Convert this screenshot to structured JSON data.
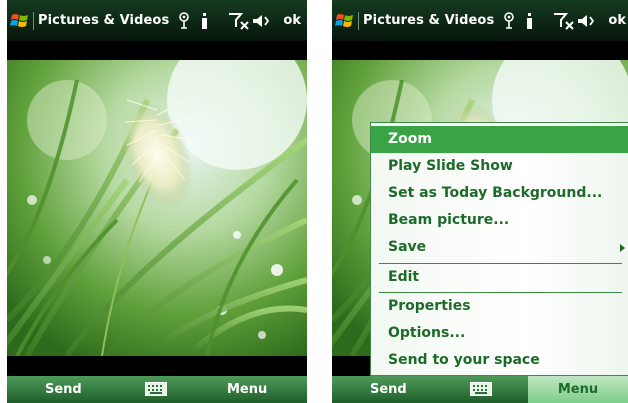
{
  "screens": {
    "left": {
      "title": "Pictures & Videos",
      "ok_label": "ok",
      "softkeys": {
        "left": "Send",
        "right": "Menu"
      }
    },
    "right": {
      "title": "Pictures & Videos",
      "ok_label": "ok",
      "softkeys": {
        "left": "Send",
        "right": "Menu"
      },
      "menu": {
        "items": [
          {
            "label": "Zoom",
            "selected": true
          },
          {
            "label": "Play Slide Show"
          },
          {
            "label": "Set as Today Background..."
          },
          {
            "label": "Beam picture..."
          },
          {
            "label": "Save",
            "submenu": true
          },
          {
            "label": "Edit"
          },
          {
            "label": "Properties"
          },
          {
            "label": "Options..."
          },
          {
            "label": "Send to your space"
          }
        ]
      }
    }
  },
  "icons": [
    "windows-flag-icon",
    "connectivity-icon",
    "battery-icon",
    "signal-off-icon",
    "speaker-muted-icon",
    "keyboard-icon",
    "submenu-arrow-icon"
  ],
  "colors": {
    "accent": "#3aa346",
    "menu_text": "#1d6b2a",
    "softbar": "#2f7a3a"
  }
}
